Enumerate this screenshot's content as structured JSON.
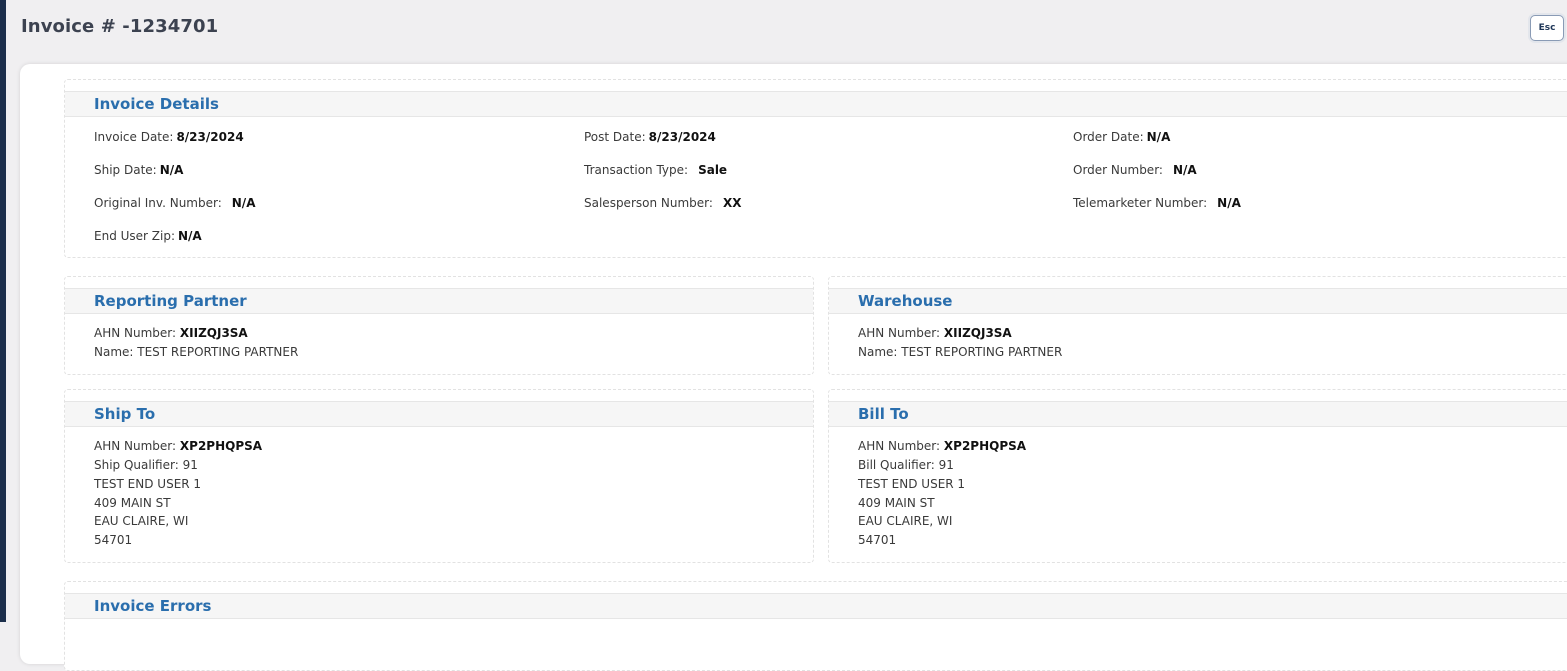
{
  "header": {
    "title": "Invoice # -1234701",
    "esc_label": "Esc"
  },
  "invoice_details": {
    "title": "Invoice Details",
    "invoice_date": {
      "label": "Invoice Date:",
      "value": "8/23/2024"
    },
    "post_date": {
      "label": "Post Date:",
      "value": "8/23/2024"
    },
    "order_date": {
      "label": "Order Date:",
      "value": "N/A"
    },
    "ship_date": {
      "label": "Ship Date:",
      "value": "N/A"
    },
    "transaction_type": {
      "label": "Transaction Type:",
      "value": "Sale"
    },
    "order_number": {
      "label": "Order Number:",
      "value": "N/A"
    },
    "original_inv_number": {
      "label": "Original Inv. Number:",
      "value": "N/A"
    },
    "salesperson_number": {
      "label": "Salesperson Number:",
      "value": "XX"
    },
    "telemarketer_number": {
      "label": "Telemarketer Number:",
      "value": "N/A"
    },
    "end_user_zip": {
      "label": "End User Zip:",
      "value": "N/A"
    }
  },
  "reporting_partner": {
    "title": "Reporting Partner",
    "ahn_label": "AHN Number:",
    "ahn_value": "XIIZQJ3SA",
    "name_line": "Name: TEST REPORTING PARTNER"
  },
  "warehouse": {
    "title": "Warehouse",
    "ahn_label": "AHN Number:",
    "ahn_value": "XIIZQJ3SA",
    "name_line": "Name: TEST REPORTING PARTNER"
  },
  "ship_to": {
    "title": "Ship To",
    "ahn_label": "AHN Number:",
    "ahn_value": "XP2PHQPSA",
    "qualifier": "Ship Qualifier: 91",
    "name": "TEST END USER 1",
    "street": "409 MAIN ST",
    "city_state": "EAU CLAIRE, WI",
    "zip": "54701"
  },
  "bill_to": {
    "title": "Bill To",
    "ahn_label": "AHN Number:",
    "ahn_value": "XP2PHQPSA",
    "qualifier": "Bill Qualifier: 91",
    "name": "TEST END USER 1",
    "street": "409 MAIN ST",
    "city_state": "EAU CLAIRE, WI",
    "zip": "54701"
  },
  "invoice_errors": {
    "title": "Invoice Errors"
  }
}
